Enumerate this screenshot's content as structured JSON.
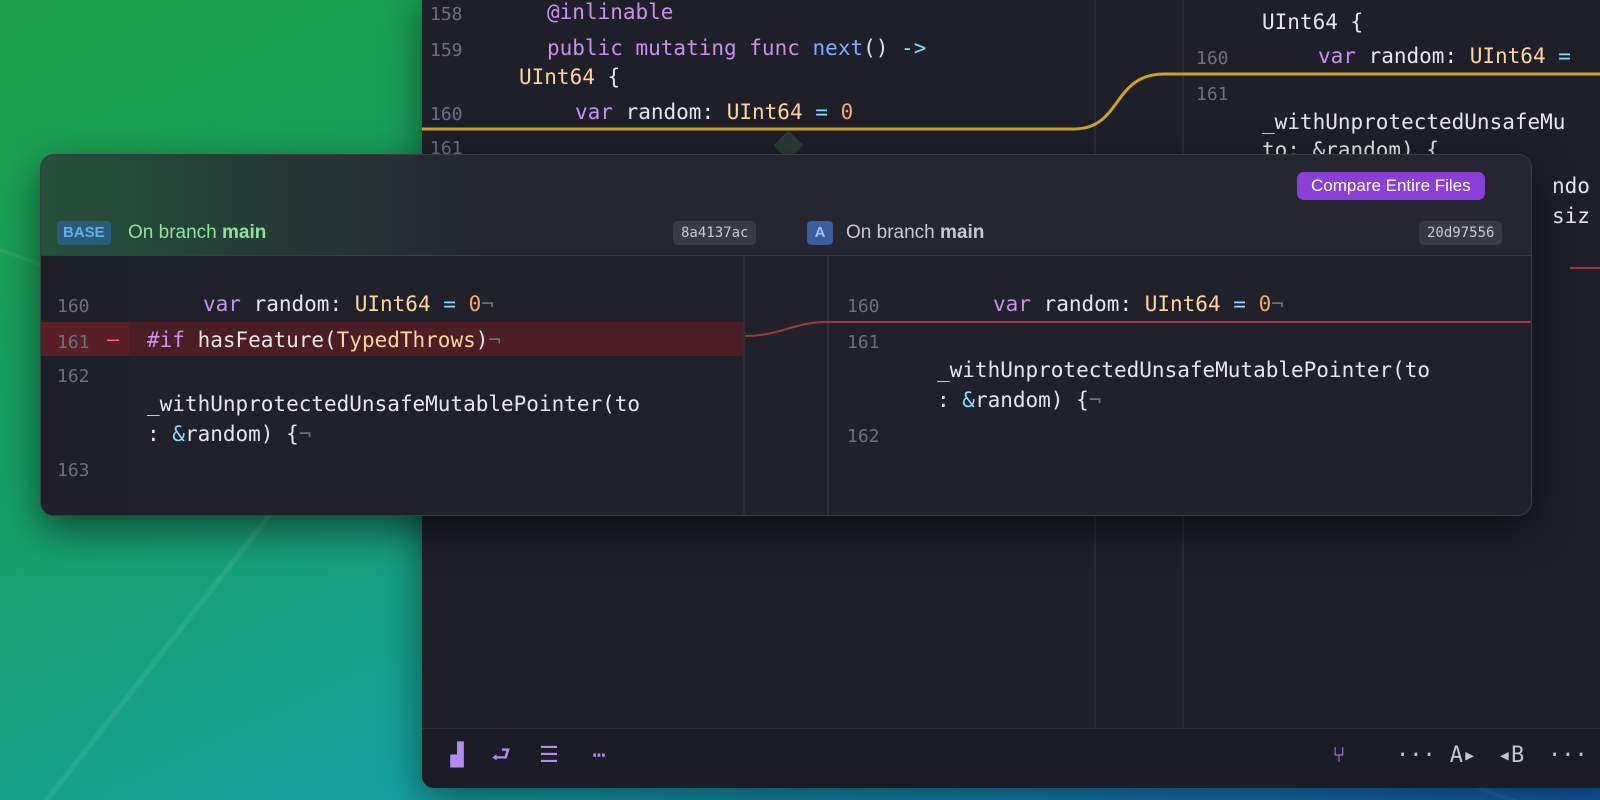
{
  "editor": {
    "left": [
      {
        "ln": "158",
        "code": "@inlinable"
      },
      {
        "ln": "159",
        "code": "public mutating func next() -> UInt64 {"
      },
      {
        "ln": "160",
        "code": "var random: UInt64 = 0"
      },
      {
        "ln": "161",
        "code": ""
      }
    ],
    "right": {
      "line0_tail": "UInt64 {",
      "ln160": "160",
      "code160": "var random: UInt64 =",
      "ln161": "161",
      "code161a": "_withUnprotectedUnsafeMu",
      "code161b": "to: &random) {",
      "frag1": "ndo",
      "frag2": "siz"
    }
  },
  "popover": {
    "compare_label": "Compare Entire Files",
    "base": {
      "badge": "BASE",
      "branch_prefix": "On branch ",
      "branch": "main",
      "hash": "8a4137ac"
    },
    "a": {
      "badge": "A",
      "branch_prefix": "On branch ",
      "branch": "main",
      "hash": "20d97556"
    },
    "left_lines": [
      {
        "ln": "160",
        "code": "var random: UInt64 = 0¬"
      },
      {
        "ln": "161",
        "mark": "–",
        "code": "#if hasFeature(TypedThrows)¬"
      },
      {
        "ln": "162",
        "code1": "_withUnprotectedUnsafeMutablePointer(to",
        "code2": ": &random) {¬"
      },
      {
        "ln": "163"
      }
    ],
    "right_lines": [
      {
        "ln": "160",
        "code": "var random: UInt64 = 0¬"
      },
      {
        "ln": "161",
        "code1": "_withUnprotectedUnsafeMutablePointer(to",
        "code2": ": &random) {¬"
      },
      {
        "ln": "162"
      }
    ]
  },
  "toolbar": {
    "more_label": "···",
    "a_label": "A▸",
    "b_label": "◂B",
    "more_right": "···"
  },
  "colors": {
    "accent": "#8a3fd6",
    "conflict_line": "#c9a227",
    "deleted_line": "#a03a3a"
  }
}
